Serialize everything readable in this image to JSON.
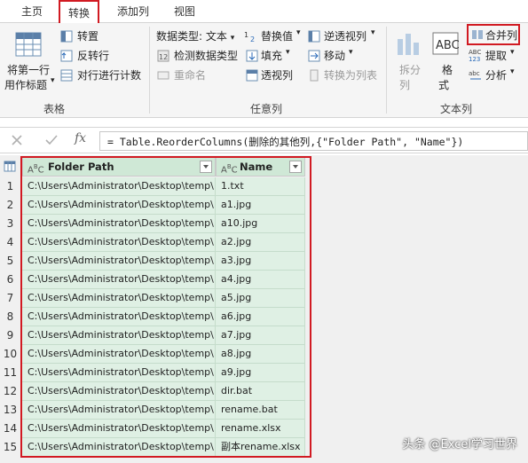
{
  "tabs": [
    {
      "label": "主页",
      "active": false
    },
    {
      "label": "转换",
      "active": true
    },
    {
      "label": "添加列",
      "active": false
    },
    {
      "label": "视图",
      "active": false
    }
  ],
  "ribbon": {
    "table_group": {
      "label": "表格",
      "use_first_row": "将第一行\n用作标题",
      "use_first_row_l1": "将第一行",
      "use_first_row_l2": "用作标题",
      "transpose": "转置",
      "reverse_rows": "反转行",
      "count_rows": "对行进行计数"
    },
    "any_column_group": {
      "label": "任意列",
      "data_type": "数据类型: 文本",
      "detect_type": "检测数据类型",
      "rename": "重命名",
      "replace_values": "替换值",
      "fill": "填充",
      "pivot": "透视列",
      "unpivot": "逆透视列",
      "move": "移动",
      "to_list": "转换为列表"
    },
    "text_column_group": {
      "label": "文本列",
      "split": "拆分\n列",
      "split_l1": "拆分",
      "split_l2": "列",
      "format_l1": "格",
      "format_l2": "式",
      "merge": "合并列",
      "extract": "提取",
      "parse": "分析"
    }
  },
  "formula": {
    "cancel_icon": "close-icon",
    "confirm_icon": "check-icon",
    "fx": "fx",
    "text": "= Table.ReorderColumns(删除的其他列,{\"Folder Path\", \"Name\"})"
  },
  "table": {
    "columns": [
      "Folder Path",
      "Name"
    ],
    "rows": [
      {
        "n": "1",
        "path": "C:\\Users\\Administrator\\Desktop\\temp\\",
        "name": "1.txt"
      },
      {
        "n": "2",
        "path": "C:\\Users\\Administrator\\Desktop\\temp\\",
        "name": "a1.jpg"
      },
      {
        "n": "3",
        "path": "C:\\Users\\Administrator\\Desktop\\temp\\",
        "name": "a10.jpg"
      },
      {
        "n": "4",
        "path": "C:\\Users\\Administrator\\Desktop\\temp\\",
        "name": "a2.jpg"
      },
      {
        "n": "5",
        "path": "C:\\Users\\Administrator\\Desktop\\temp\\",
        "name": "a3.jpg"
      },
      {
        "n": "6",
        "path": "C:\\Users\\Administrator\\Desktop\\temp\\",
        "name": "a4.jpg"
      },
      {
        "n": "7",
        "path": "C:\\Users\\Administrator\\Desktop\\temp\\",
        "name": "a5.jpg"
      },
      {
        "n": "8",
        "path": "C:\\Users\\Administrator\\Desktop\\temp\\",
        "name": "a6.jpg"
      },
      {
        "n": "9",
        "path": "C:\\Users\\Administrator\\Desktop\\temp\\",
        "name": "a7.jpg"
      },
      {
        "n": "10",
        "path": "C:\\Users\\Administrator\\Desktop\\temp\\",
        "name": "a8.jpg"
      },
      {
        "n": "11",
        "path": "C:\\Users\\Administrator\\Desktop\\temp\\",
        "name": "a9.jpg"
      },
      {
        "n": "12",
        "path": "C:\\Users\\Administrator\\Desktop\\temp\\",
        "name": "dir.bat"
      },
      {
        "n": "13",
        "path": "C:\\Users\\Administrator\\Desktop\\temp\\",
        "name": "rename.bat"
      },
      {
        "n": "14",
        "path": "C:\\Users\\Administrator\\Desktop\\temp\\",
        "name": "rename.xlsx"
      },
      {
        "n": "15",
        "path": "C:\\Users\\Administrator\\Desktop\\temp\\",
        "name": "副本rename.xlsx"
      }
    ]
  },
  "watermark": "头条 @Excel学习世界",
  "colors": {
    "highlight_red": "#d11a22",
    "selected_column_bg": "#dff0e4",
    "ribbon_bg": "#f5f5f5"
  }
}
